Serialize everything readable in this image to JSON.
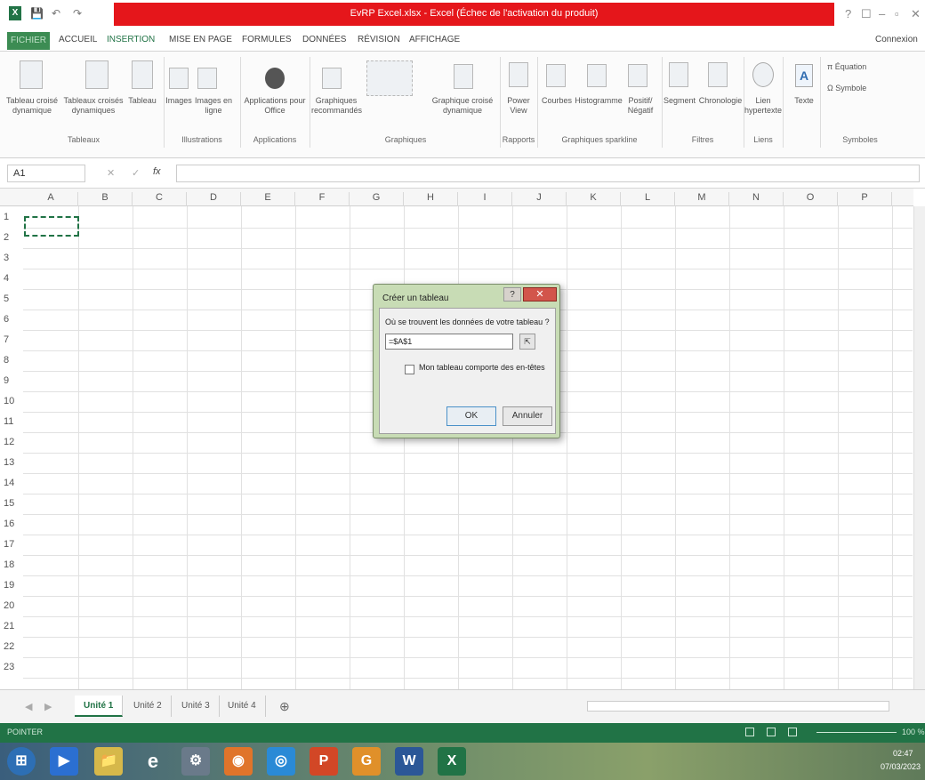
{
  "window": {
    "title": "EvRP Excel.xlsx - Excel (Échec de l'activation du produit)",
    "controls": [
      "?",
      "☐",
      "–",
      "▫",
      "✕"
    ]
  },
  "quick_access": [
    "💾",
    "↶",
    "↷"
  ],
  "ribbon_tabs": {
    "file": "FICHIER",
    "tabs": [
      "ACCUEIL",
      "INSERTION",
      "MISE EN PAGE",
      "FORMULES",
      "DONNÉES",
      "RÉVISION",
      "AFFICHAGE"
    ],
    "account": "Connexion"
  },
  "ribbon": {
    "buttons": {
      "tcd": "Tableau croisé dynamique",
      "tcdr": "Tableaux croisés dynamiques",
      "tableau": "Tableau",
      "images": "Images",
      "images_en_ligne": "Images en ligne",
      "apps": "Applications pour Office",
      "graph_rec": "Graphiques recommandés",
      "gcd": "Graphique croisé dynamique",
      "power_view": "Power View",
      "courbes": "Courbes",
      "histogramme": "Histogramme",
      "positif": "Positif/ Négatif",
      "segment": "Segment",
      "chrono": "Chronologie",
      "lien": "Lien hypertexte",
      "texte": "Texte",
      "equation": "π Équation",
      "symbole": "Ω Symbole"
    },
    "groups": {
      "tableaux": "Tableaux",
      "illustrations": "Illustrations",
      "applications": "Applications",
      "graphiques": "Graphiques",
      "rapports": "Rapports",
      "sparklines": "Graphiques sparkline",
      "filtres": "Filtres",
      "liens": "Liens",
      "symboles": "Symboles"
    }
  },
  "formula_bar": {
    "name_box": "A1",
    "cancel": "✕",
    "enter": "✓",
    "fx": "fx",
    "value": ""
  },
  "grid": {
    "columns": [
      "A",
      "B",
      "C",
      "D",
      "E",
      "F",
      "G",
      "H",
      "I",
      "J",
      "K",
      "L",
      "M",
      "N",
      "O",
      "P"
    ],
    "rows": [
      "1",
      "2",
      "3",
      "4",
      "5",
      "6",
      "7",
      "8",
      "9",
      "10",
      "11",
      "12",
      "13",
      "14",
      "15",
      "16",
      "17",
      "18",
      "19",
      "20",
      "21",
      "22",
      "23"
    ]
  },
  "sheets": {
    "tabs": [
      "Unité 1",
      "Unité 2",
      "Unité 3",
      "Unité 4"
    ],
    "active": "Unité 1",
    "add": "⊕"
  },
  "status_bar": {
    "mode": "POINTER",
    "zoom": "100 %"
  },
  "dialog": {
    "title": "Créer un tableau",
    "help": "?",
    "close": "✕",
    "question": "Où se trouvent les données de votre tableau ?",
    "range_value": "=$A$1",
    "checkbox_label": "Mon tableau comporte des en-têtes",
    "ok": "OK",
    "cancel": "Annuler"
  },
  "taskbar": {
    "apps": [
      "⊞",
      "▶",
      "📁",
      "e",
      "⚙",
      "◉",
      "◎",
      "P",
      "G",
      "W",
      "X"
    ],
    "time": "02:47",
    "date": "07/03/2023"
  },
  "colors": {
    "excel_green": "#217346",
    "title_red": "#e5161b",
    "dialog_frame": "#c8dcb5"
  }
}
